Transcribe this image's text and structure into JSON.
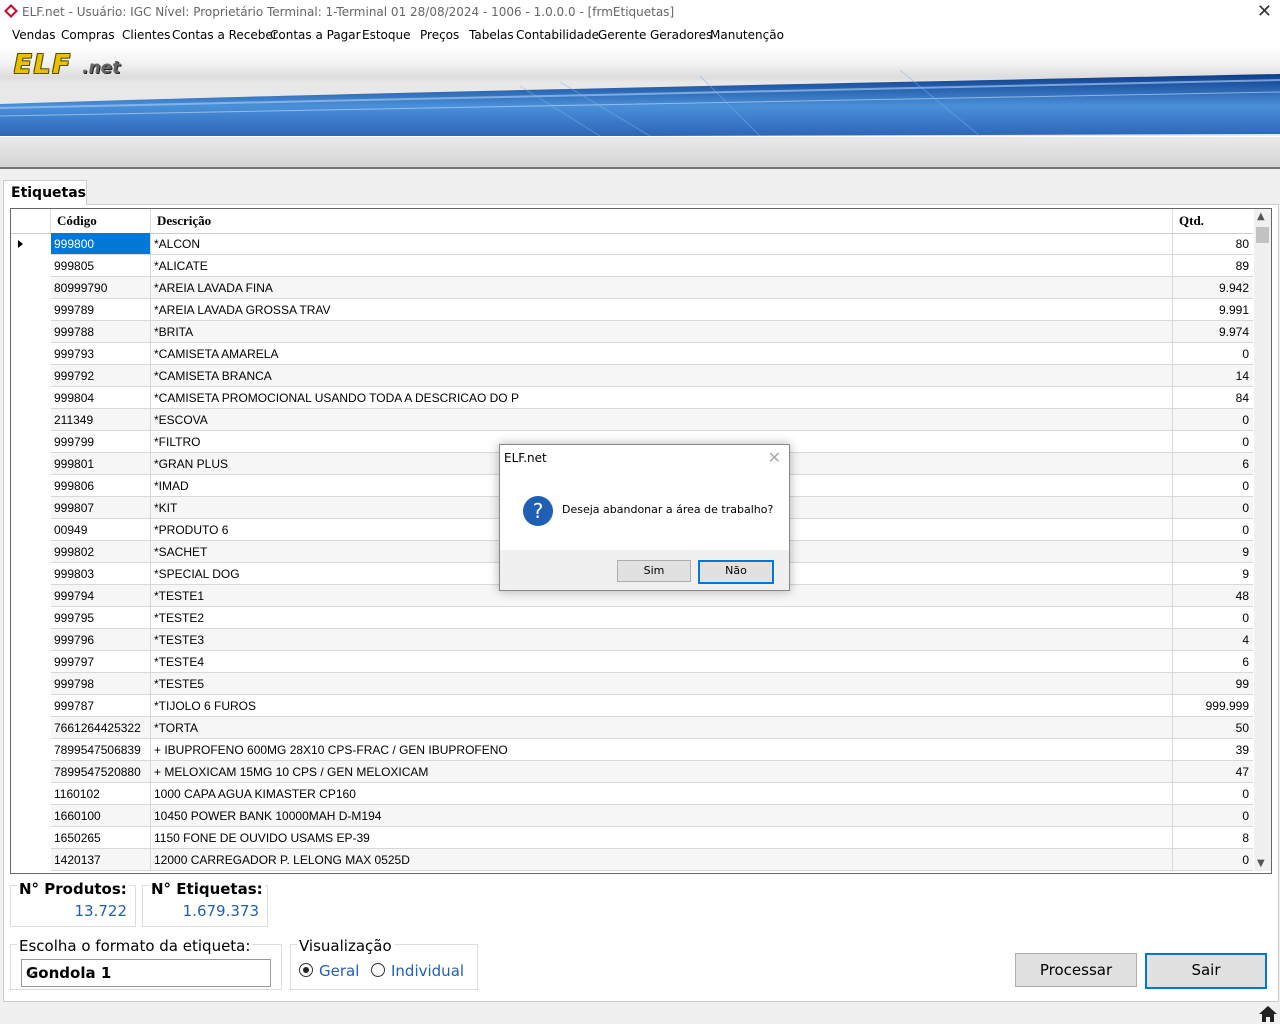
{
  "window": {
    "title": "ELF.net -   Usuário: IGC    Nível: Proprietário    Terminal: 1-Terminal 01    28/08/2024 - 1006 - 1.0.0.0 - [frmEtiquetas]",
    "close": "✕"
  },
  "menu": [
    "Vendas",
    "Compras",
    "Clientes",
    "Contas a Receber",
    "Contas a Pagar",
    "Estoque",
    "Preços",
    "Tabelas",
    "Contabilidade",
    "Gerente",
    "Geradores",
    "Manutenção"
  ],
  "logo": {
    "main": "ELF",
    "suffix": ".net"
  },
  "tab": {
    "label": "Etiquetas"
  },
  "grid": {
    "columns": {
      "code": "Código",
      "desc": "Descrição",
      "qty": "Qtd."
    },
    "rows": [
      {
        "code": "999800",
        "desc": "*ALCON",
        "qty": "80"
      },
      {
        "code": "999805",
        "desc": "*ALICATE",
        "qty": "89"
      },
      {
        "code": "80999790",
        "desc": "*AREIA LAVADA FINA",
        "qty": "9.942"
      },
      {
        "code": "999789",
        "desc": "*AREIA LAVADA GROSSA TRAV",
        "qty": "9.991"
      },
      {
        "code": "999788",
        "desc": "*BRITA",
        "qty": "9.974"
      },
      {
        "code": "999793",
        "desc": "*CAMISETA AMARELA",
        "qty": "0"
      },
      {
        "code": "999792",
        "desc": "*CAMISETA BRANCA",
        "qty": "14"
      },
      {
        "code": "999804",
        "desc": "*CAMISETA PROMOCIONAL USANDO TODA A DESCRICAO DO P",
        "qty": "84"
      },
      {
        "code": "211349",
        "desc": "*ESCOVA",
        "qty": "0"
      },
      {
        "code": "999799",
        "desc": "*FILTRO",
        "qty": "0"
      },
      {
        "code": "999801",
        "desc": "*GRAN PLUS",
        "qty": "6"
      },
      {
        "code": "999806",
        "desc": "*IMAD",
        "qty": "0"
      },
      {
        "code": "999807",
        "desc": "*KIT",
        "qty": "0"
      },
      {
        "code": "00949",
        "desc": "*PRODUTO 6",
        "qty": "0"
      },
      {
        "code": "999802",
        "desc": "*SACHET",
        "qty": "9"
      },
      {
        "code": "999803",
        "desc": "*SPECIAL DOG",
        "qty": "9"
      },
      {
        "code": "999794",
        "desc": "*TESTE1",
        "qty": "48"
      },
      {
        "code": "999795",
        "desc": "*TESTE2",
        "qty": "0"
      },
      {
        "code": "999796",
        "desc": "*TESTE3",
        "qty": "4"
      },
      {
        "code": "999797",
        "desc": "*TESTE4",
        "qty": "6"
      },
      {
        "code": "999798",
        "desc": "*TESTE5",
        "qty": "99"
      },
      {
        "code": "999787",
        "desc": "*TIJOLO 6 FUROS",
        "qty": "999.999"
      },
      {
        "code": "7661264425322",
        "desc": "*TORTA",
        "qty": "50"
      },
      {
        "code": "7899547506839",
        "desc": "+ IBUPROFENO 600MG 28X10 CPS-FRAC / GEN IBUPROFENO",
        "qty": "39"
      },
      {
        "code": "7899547520880",
        "desc": "+ MELOXICAM 15MG 10 CPS / GEN MELOXICAM",
        "qty": "47"
      },
      {
        "code": "1160102",
        "desc": "1000 CAPA AGUA KIMASTER CP160",
        "qty": "0"
      },
      {
        "code": "1660100",
        "desc": "10450 POWER BANK 10000MAH D-M194",
        "qty": "0"
      },
      {
        "code": "1650265",
        "desc": "1150 FONE DE OUVIDO USAMS EP-39",
        "qty": "8"
      },
      {
        "code": "1420137",
        "desc": "12000 CARREGADOR P. LELONG MAX 0525D",
        "qty": "0"
      }
    ]
  },
  "summary": {
    "produtos_label": "N° Produtos:",
    "produtos_value": "13.722",
    "etiquetas_label": "N° Etiquetas:",
    "etiquetas_value": "1.679.373"
  },
  "format": {
    "label": "Escolha o formato da etiqueta:",
    "selected": "Gondola 1"
  },
  "view": {
    "label": "Visualização",
    "opt_geral": "Geral",
    "opt_individual": "Individual",
    "selected": "Geral"
  },
  "buttons": {
    "processar": "Processar",
    "sair": "Sair"
  },
  "dialog": {
    "title": "ELF.net",
    "message": "Deseja abandonar a área de trabalho?",
    "yes": "Sim",
    "no": "Não"
  },
  "colors": {
    "accent": "#0078d7",
    "value_blue": "#1f5fb4"
  }
}
